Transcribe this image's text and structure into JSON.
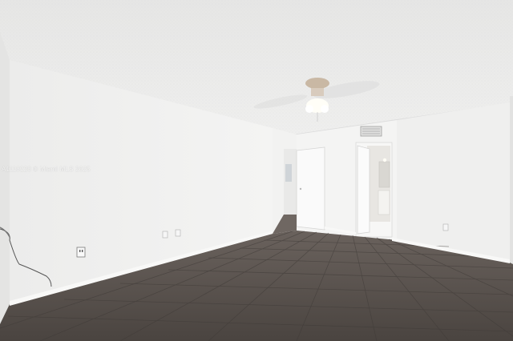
{
  "photo": {
    "subject": "empty-bedroom-interior",
    "watermark": "A1118228 © Miami MLS 2025"
  },
  "colors": {
    "ceiling": "#ebebea",
    "wall_left": "#f1f1f0",
    "wall_back": "#f3f3f2",
    "wall_right": "#efefee",
    "floor": "#4e4844",
    "baseboard": "#f7f7f6"
  }
}
